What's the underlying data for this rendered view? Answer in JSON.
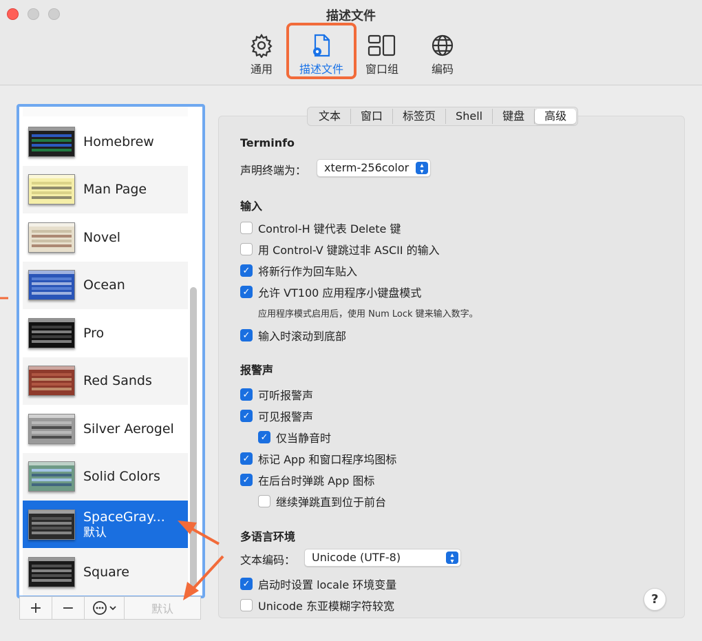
{
  "window": {
    "title": "描述文件"
  },
  "toolbar": {
    "items": [
      {
        "label": "通用",
        "icon": "gear-icon"
      },
      {
        "label": "描述文件",
        "icon": "profile-document-icon",
        "active": true
      },
      {
        "label": "窗口组",
        "icon": "window-groups-icon"
      },
      {
        "label": "编码",
        "icon": "globe-icon"
      }
    ]
  },
  "profiles": {
    "items": [
      {
        "name": "Homebrew",
        "colors": {
          "bg": "#1f1f1f",
          "accent": "#22c55e",
          "row": "#2d5fd0"
        }
      },
      {
        "name": "Man Page",
        "colors": {
          "bg": "#f5eea8",
          "accent": "#3a3a3a",
          "row": "#d8cf85"
        }
      },
      {
        "name": "Novel",
        "colors": {
          "bg": "#e7dfcc",
          "accent": "#7b3f2a",
          "row": "#c8bda3"
        }
      },
      {
        "name": "Ocean",
        "colors": {
          "bg": "#2a55b8",
          "accent": "#ffffff",
          "row": "#5b83d6"
        }
      },
      {
        "name": "Pro",
        "colors": {
          "bg": "#111111",
          "accent": "#d8d8d8",
          "row": "#444444"
        }
      },
      {
        "name": "Red Sands",
        "colors": {
          "bg": "#8e3a2c",
          "accent": "#e8cfa0",
          "row": "#b25a45"
        }
      },
      {
        "name": "Silver Aerogel",
        "colors": {
          "bg": "#9a9a9a",
          "accent": "#111111",
          "row": "#bcbcbc"
        }
      },
      {
        "name": "Solid Colors",
        "colors": {
          "bg": "#6e9a86",
          "accent": "#1f3d7a",
          "row": "#a8c8f0"
        }
      },
      {
        "name": "SpaceGray...",
        "subtitle": "默认",
        "selected": true,
        "colors": {
          "bg": "#2b2b2b",
          "accent": "#cfcfcf",
          "row": "#5a5a5a"
        }
      },
      {
        "name": "Square",
        "colors": {
          "bg": "#1a1a1a",
          "accent": "#dcdcdc",
          "row": "#555555"
        }
      }
    ],
    "add_label": "+",
    "remove_label": "−",
    "more_label": "⊙⌄",
    "default_label": "默认"
  },
  "tabs": [
    {
      "label": "文本"
    },
    {
      "label": "窗口"
    },
    {
      "label": "标签页"
    },
    {
      "label": "Shell"
    },
    {
      "label": "键盘"
    },
    {
      "label": "高级",
      "active": true
    }
  ],
  "terminfo": {
    "heading": "Terminfo",
    "declare_label": "声明终端为：",
    "declare_value": "xterm-256color"
  },
  "input": {
    "heading": "输入",
    "options": [
      {
        "label": "Control-H 键代表 Delete 键",
        "checked": false
      },
      {
        "label": "用 Control-V 键跳过非 ASCII 的输入",
        "checked": false
      },
      {
        "label": "将新行作为回车贴入",
        "checked": true
      },
      {
        "label": "允许 VT100 应用程序小键盘模式",
        "checked": true
      }
    ],
    "hint": "应用程序模式启用后，使用 Num Lock 键来输入数字。",
    "scroll_option": {
      "label": "输入时滚动到底部",
      "checked": true
    }
  },
  "alerts": {
    "heading": "报警声",
    "options": [
      {
        "label": "可听报警声",
        "checked": true
      },
      {
        "label": "可见报警声",
        "checked": true
      },
      {
        "label": "仅当静音时",
        "checked": true
      },
      {
        "label": "标记 App 和窗口程序坞图标",
        "checked": true
      },
      {
        "label": "在后台时弹跳 App 图标",
        "checked": true
      },
      {
        "label": "继续弹跳直到位于前台",
        "checked": false
      }
    ]
  },
  "language": {
    "heading": "多语言环境",
    "encoding_label": "文本编码：",
    "encoding_value": "Unicode (UTF-8)",
    "options": [
      {
        "label": "启动时设置 locale 环境变量",
        "checked": true
      },
      {
        "label": "Unicode 东亚模糊字符较宽",
        "checked": false
      }
    ]
  },
  "help": {
    "label": "?"
  },
  "colors": {
    "accent": "#1a6fe0",
    "annotation": "#f26b3a",
    "list_focus": "#6fa8f0"
  }
}
